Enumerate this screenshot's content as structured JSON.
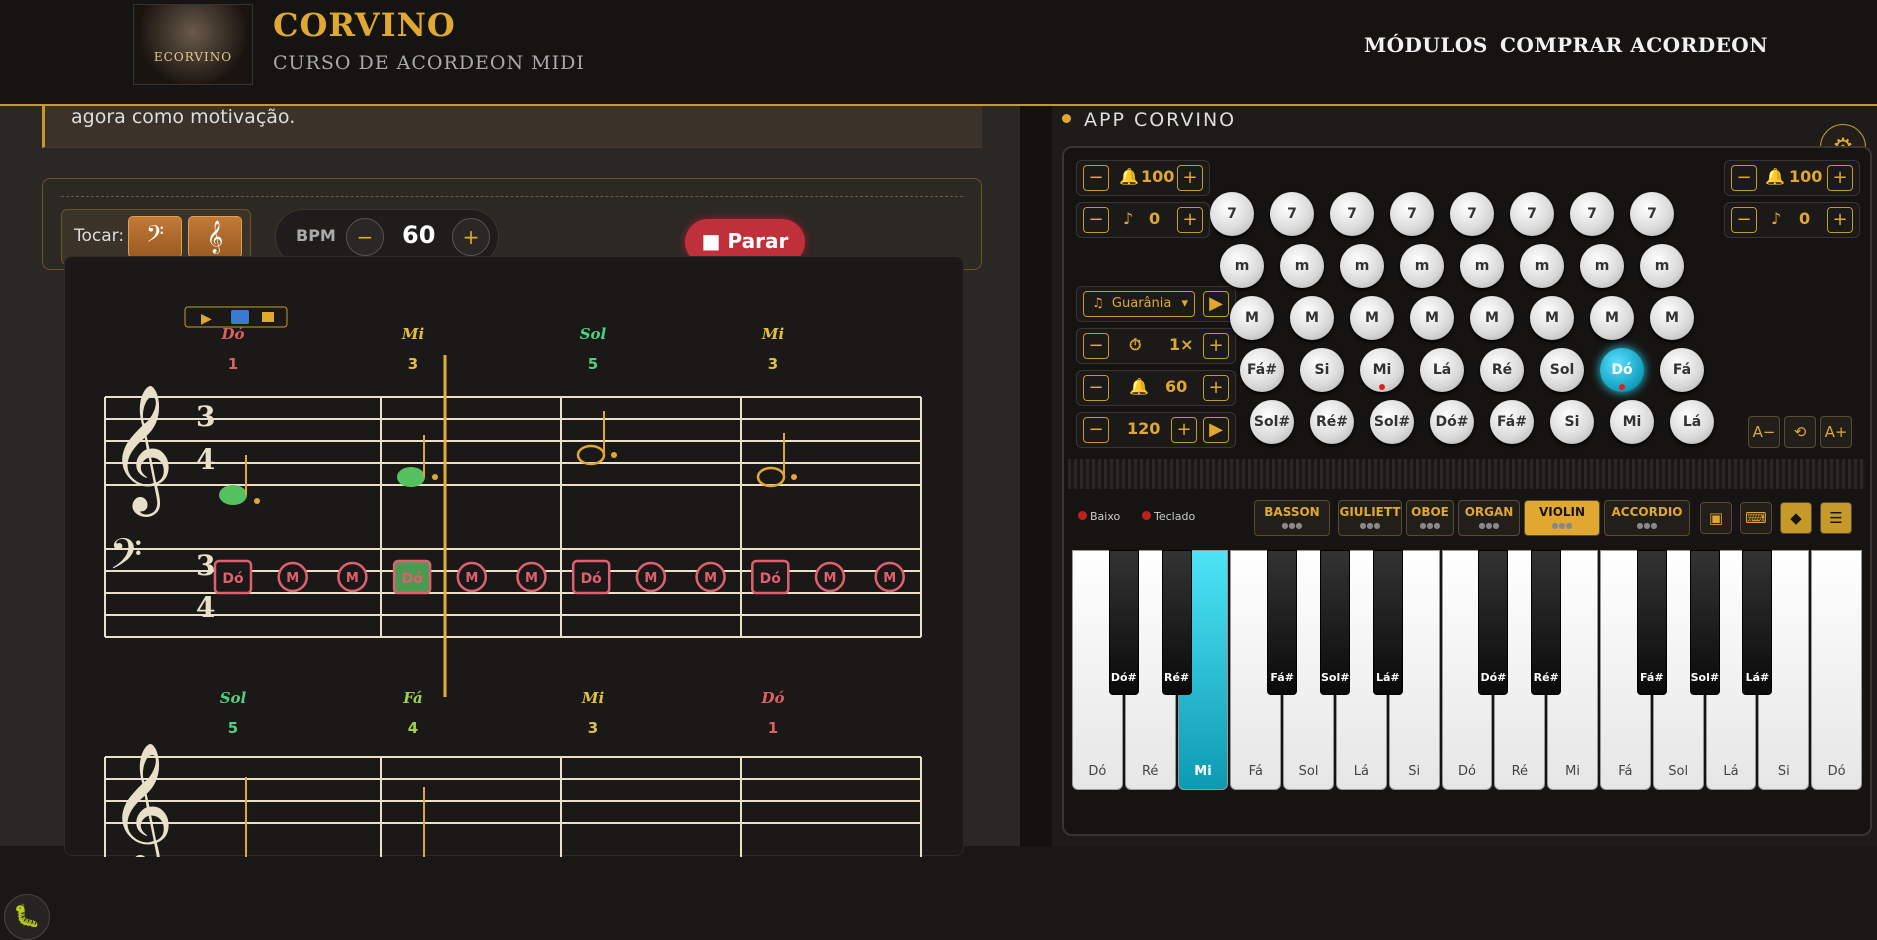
{
  "header": {
    "title": "CORVINO",
    "subtitle": "CURSO DE ACORDEON MIDI",
    "logo_text": "ECORVINO",
    "nav": [
      "MÓDULOS",
      "COMPRAR ACORDEON"
    ]
  },
  "lesson": {
    "note_text": "agora como motivação.",
    "tocar_label": "Tocar:",
    "bass_clef_icon": "𝄢",
    "treble_clef_icon": "𝄞",
    "bpm_label": "BPM",
    "bpm_value": "60",
    "bpm_minus": "−",
    "bpm_plus": "+",
    "stop_label": "■ Parar"
  },
  "score": {
    "row1": {
      "notes": [
        "Dó",
        "Mi",
        "Sol",
        "Mi"
      ],
      "fingers": [
        "1",
        "3",
        "5",
        "3"
      ],
      "note_colors": [
        "#e06060",
        "#e0c040",
        "#50d080",
        "#e0c040"
      ],
      "time_sig": [
        "3",
        "4"
      ],
      "bass_buttons": [
        "Dó",
        "M",
        "M",
        "Dó",
        "M",
        "M",
        "Dó",
        "M",
        "M",
        "Dó",
        "M",
        "M"
      ]
    },
    "row2": {
      "notes": [
        "Sol",
        "Fá",
        "Mi",
        "Dó"
      ],
      "fingers": [
        "5",
        "4",
        "3",
        "1"
      ],
      "note_colors": [
        "#50d080",
        "#a0d050",
        "#e0c040",
        "#e06060"
      ]
    }
  },
  "app": {
    "title": "APP CORVINO",
    "gear_icon": "⚙",
    "left_vol": "100",
    "left_trans": "0",
    "right_vol": "100",
    "right_trans": "0",
    "rhythm_select": "Guarânia",
    "speed": "1×",
    "metro_vol": "60",
    "tempo": "120",
    "row7": [
      "7",
      "7",
      "7",
      "7",
      "7",
      "7",
      "7",
      "7"
    ],
    "rowm": [
      "m",
      "m",
      "m",
      "m",
      "m",
      "m",
      "m",
      "m"
    ],
    "rowM": [
      "M",
      "M",
      "M",
      "M",
      "M",
      "M",
      "M",
      "M"
    ],
    "row_fund": [
      "Fá#",
      "Si",
      "Mi",
      "Lá",
      "Ré",
      "Sol",
      "Dó",
      "Fá"
    ],
    "row_cb": [
      "Sol#",
      "Ré#",
      "Sol#",
      "Dó#",
      "Fá#",
      "Si",
      "Mi",
      "Lá"
    ],
    "side_btns": [
      "A−",
      "⟲",
      "A+"
    ],
    "toggles": [
      "Baixo",
      "Teclado"
    ],
    "registers": [
      "BASSON",
      "GIULIETT",
      "OBOE",
      "ORGAN",
      "VIOLIN",
      "ACCORDIO"
    ],
    "active_register": "VIOLIN",
    "white_keys": [
      "Dó",
      "Ré",
      "Mi",
      "Fá",
      "Sol",
      "Lá",
      "Si",
      "Dó",
      "Ré",
      "Mi",
      "Fá",
      "Sol",
      "Lá",
      "Si",
      "Dó"
    ],
    "black_keys": [
      "Dó#",
      "Ré#",
      "Fá#",
      "Sol#",
      "Lá#",
      "Dó#",
      "Ré#",
      "Fá#",
      "Sol#",
      "Lá#"
    ],
    "active_white_key": "Mi"
  }
}
